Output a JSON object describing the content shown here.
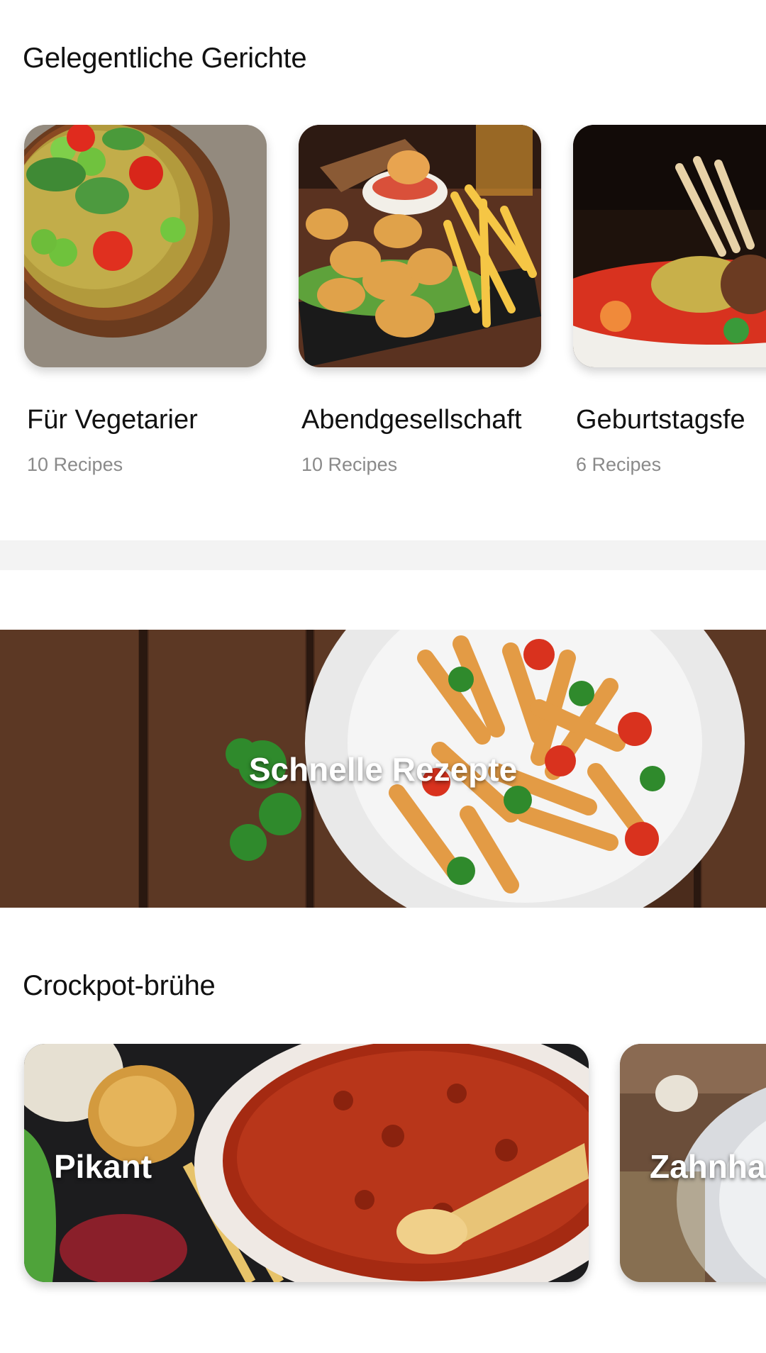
{
  "occasions": {
    "title": "Gelegentliche Gerichte",
    "items": [
      {
        "name": "Für Vegetarier",
        "count": "10 Recipes"
      },
      {
        "name": "Abendgesellschaft",
        "count": "10 Recipes"
      },
      {
        "name": "Geburtstagsfe",
        "count": "6 Recipes"
      }
    ]
  },
  "banner": {
    "label": "Schnelle Rezepte"
  },
  "broth": {
    "title": "Crockpot-brühe",
    "items": [
      {
        "label": "Pikant"
      },
      {
        "label": "Zahnha"
      }
    ]
  }
}
